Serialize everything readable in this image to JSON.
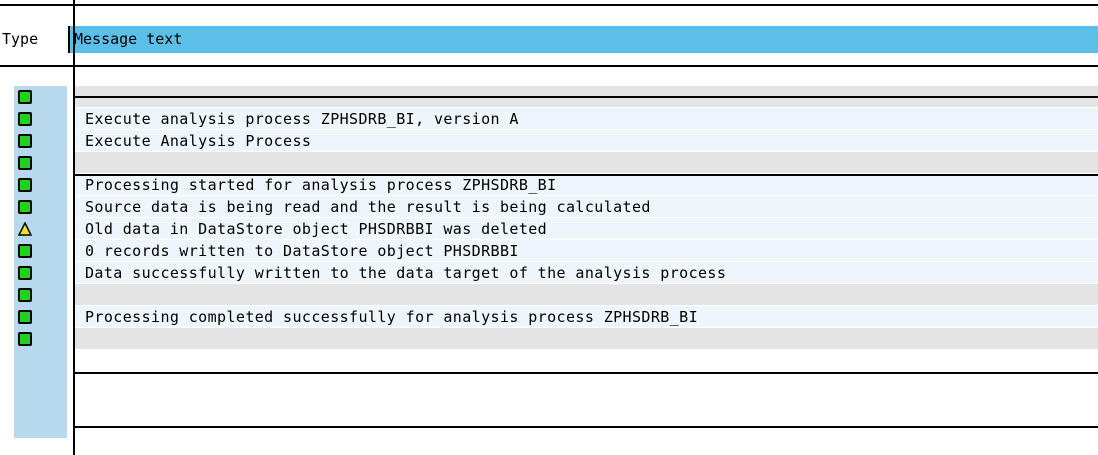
{
  "header": {
    "type_label": "Type",
    "message_label": "Message text"
  },
  "colors": {
    "header_accent": "#5bbfe8",
    "ok_status": "#1fd21f",
    "warning_status": "#f2e21c"
  },
  "messages": [
    {
      "type": "success",
      "icon": "green-square-icon",
      "text": ""
    },
    {
      "type": "success",
      "icon": "green-square-icon",
      "text": "Execute analysis process ZPHSDRB_BI, version A"
    },
    {
      "type": "success",
      "icon": "green-square-icon",
      "text": "Execute Analysis Process"
    },
    {
      "type": "success",
      "icon": "green-square-icon",
      "text": ""
    },
    {
      "type": "success",
      "icon": "green-square-icon",
      "text": "Processing started for analysis process ZPHSDRB_BI"
    },
    {
      "type": "success",
      "icon": "green-square-icon",
      "text": "Source data is being read and the result is being calculated"
    },
    {
      "type": "warning",
      "icon": "warning-triangle-icon",
      "text": "Old data in DataStore object PHSDRBBI was deleted"
    },
    {
      "type": "success",
      "icon": "green-square-icon",
      "text": "0 records written to DataStore object PHSDRBBI"
    },
    {
      "type": "success",
      "icon": "green-square-icon",
      "text": "Data successfully written to the data target of the analysis process"
    },
    {
      "type": "success",
      "icon": "green-square-icon",
      "text": ""
    },
    {
      "type": "success",
      "icon": "green-square-icon",
      "text": "Processing completed successfully for analysis process ZPHSDRB_BI"
    },
    {
      "type": "success",
      "icon": "green-square-icon",
      "text": ""
    }
  ]
}
